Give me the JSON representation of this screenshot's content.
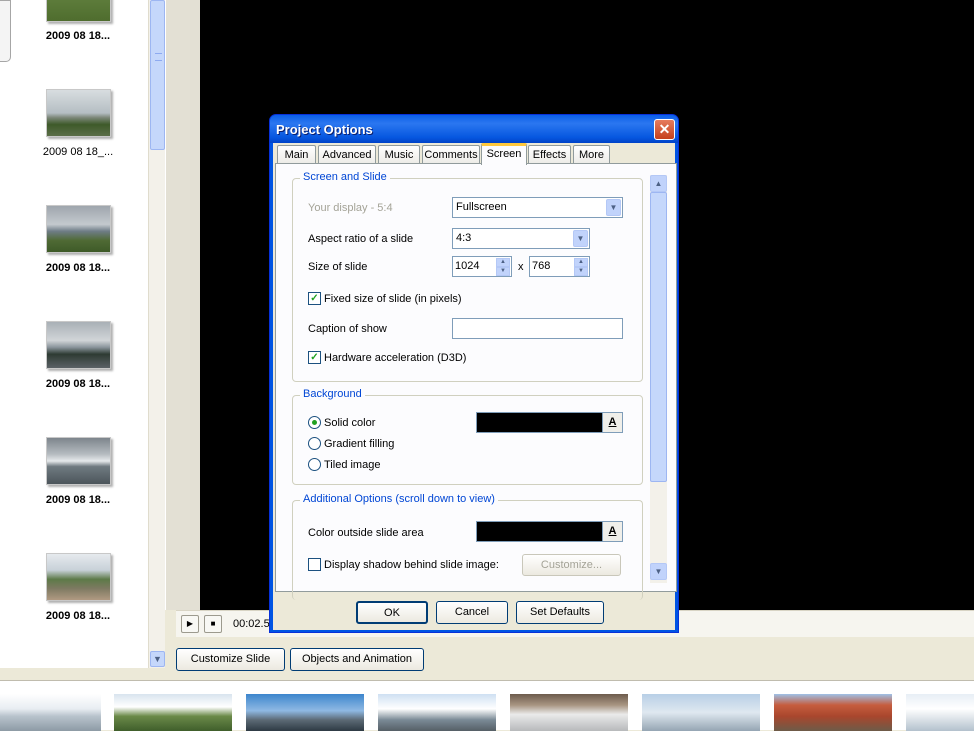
{
  "thumbnails": [
    {
      "caption": "2009 08 18...",
      "bold": true
    },
    {
      "caption": "2009 08 18_...",
      "bold": false
    },
    {
      "caption": "2009 08 18...",
      "bold": true
    },
    {
      "caption": "2009 08 18...",
      "bold": true
    },
    {
      "caption": "2009 08 18...",
      "bold": true
    },
    {
      "caption": "2009 08 18...",
      "bold": true
    }
  ],
  "player": {
    "time": "00:02.5",
    "play_icon": "play-icon",
    "stop_icon": "stop-icon"
  },
  "bottom_buttons": {
    "customize_slide": "Customize Slide",
    "objects_animation": "Objects and Animation"
  },
  "dialog": {
    "title": "Project Options",
    "tabs": [
      {
        "label": "Main",
        "active": false
      },
      {
        "label": "Advanced",
        "active": false
      },
      {
        "label": "Music",
        "active": false
      },
      {
        "label": "Comments",
        "active": false
      },
      {
        "label": "Screen",
        "active": true
      },
      {
        "label": "Effects",
        "active": false
      },
      {
        "label": "More",
        "active": false
      }
    ],
    "screen_and_slide": {
      "title": "Screen and Slide",
      "display_label": "Your display - 5:4",
      "display_value": "Fullscreen",
      "aspect_label": "Aspect ratio of a slide",
      "aspect_value": "4:3",
      "size_label": "Size of slide",
      "width": "1024",
      "x": "x",
      "height": "768",
      "fixed_size_label": "Fixed size of slide (in pixels)",
      "fixed_size_checked": true,
      "caption_label": "Caption of show",
      "caption_value": "",
      "hw_accel_label": "Hardware acceleration (D3D)",
      "hw_accel_checked": true
    },
    "background": {
      "title": "Background",
      "solid": "Solid color",
      "gradient": "Gradient filling",
      "tiled": "Tiled image",
      "selected": "solid",
      "color": "#000000",
      "color_btn": "A"
    },
    "additional": {
      "title": "Additional Options (scroll down to view)",
      "outside_label": "Color outside slide area",
      "outside_color": "#000000",
      "color_btn": "A",
      "shadow_label": "Display shadow behind slide image:",
      "shadow_checked": false,
      "customize": "Customize..."
    },
    "buttons": {
      "ok": "OK",
      "cancel": "Cancel",
      "set_defaults": "Set Defaults"
    }
  }
}
